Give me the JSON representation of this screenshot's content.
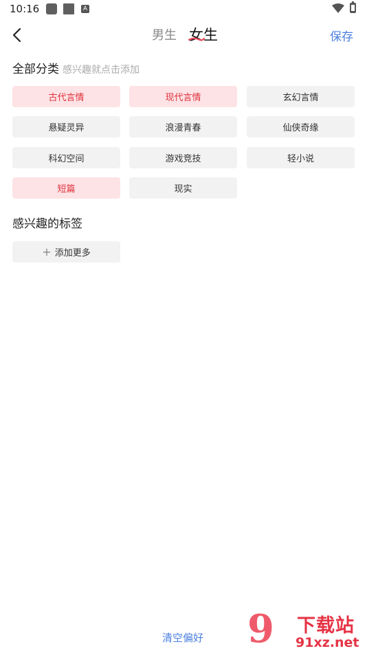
{
  "status_bar": {
    "time": "10:16",
    "a_label": "A"
  },
  "header": {
    "tab_male": "男生",
    "tab_female": "女生",
    "save": "保存"
  },
  "all_categories": {
    "title": "全部分类",
    "hint": "感兴趣就点击添加",
    "items": [
      {
        "label": "古代言情",
        "selected": true
      },
      {
        "label": "现代言情",
        "selected": true
      },
      {
        "label": "玄幻言情",
        "selected": false
      },
      {
        "label": "悬疑灵异",
        "selected": false
      },
      {
        "label": "浪漫青春",
        "selected": false
      },
      {
        "label": "仙侠奇缘",
        "selected": false
      },
      {
        "label": "科幻空间",
        "selected": false
      },
      {
        "label": "游戏竞技",
        "selected": false
      },
      {
        "label": "轻小说",
        "selected": false
      },
      {
        "label": "短篇",
        "selected": true
      },
      {
        "label": "现实",
        "selected": false
      }
    ]
  },
  "interest_tags": {
    "title": "感兴趣的标签",
    "add_more": "添加更多"
  },
  "footer": {
    "clear": "清空偏好"
  },
  "watermark": {
    "nine": "9",
    "top": "下载站",
    "bottom": "91xz.net"
  },
  "colors": {
    "accent_blue": "#4a7fe0",
    "selected_bg": "#fde3e5",
    "selected_text": "#e0323e",
    "chip_bg": "#f2f2f2"
  }
}
